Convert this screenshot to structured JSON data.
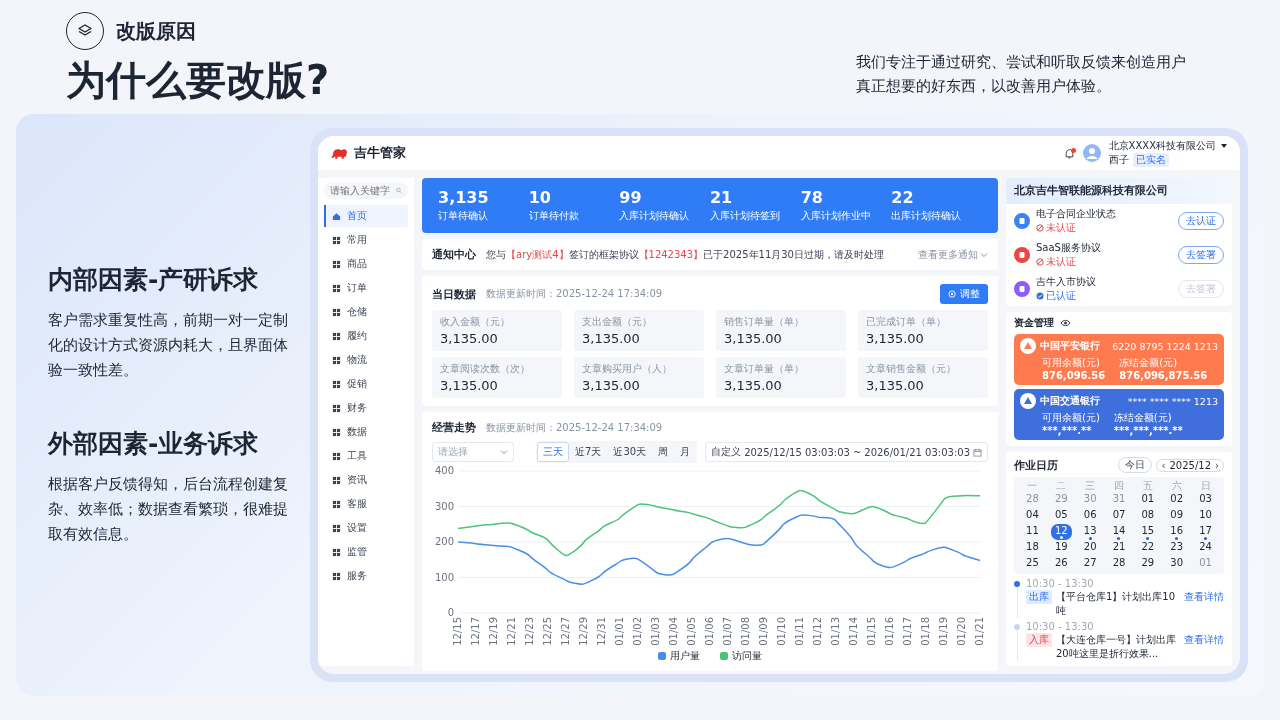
{
  "header": {
    "section_label": "改版原因",
    "title": "为什么要改版?",
    "description": "我们专注于通过研究、尝试和听取反馈来创造用户真正想要的好东西，以改善用户体验。"
  },
  "reasons": [
    {
      "heading": "内部因素-产研诉求",
      "text": "客户需求重复性高，前期一对一定制化的设计方式资源内耗大，且界面体验一致性差。"
    },
    {
      "heading": "外部因素-业务诉求",
      "text": "根据客户反馈得知，后台流程创建复杂、效率低；数据查看繁琐，很难提取有效信息。"
    }
  ],
  "app": {
    "name": "吉牛管家",
    "notification": true,
    "user": {
      "company": "北京XXXX科技有限公司",
      "name": "西子",
      "badge": "已实名"
    }
  },
  "sidebar": {
    "search_placeholder": "请输入关键字",
    "items": [
      {
        "label": "首页",
        "selected": true
      },
      {
        "label": "常用",
        "selected": false
      },
      {
        "label": "商品",
        "selected": false
      },
      {
        "label": "订单",
        "selected": false
      },
      {
        "label": "仓储",
        "selected": false
      },
      {
        "label": "履约",
        "selected": false
      },
      {
        "label": "物流",
        "selected": false
      },
      {
        "label": "促销",
        "selected": false
      },
      {
        "label": "财务",
        "selected": false
      },
      {
        "label": "数据",
        "selected": false
      },
      {
        "label": "工具",
        "selected": false
      },
      {
        "label": "资讯",
        "selected": false
      },
      {
        "label": "客服",
        "selected": false
      },
      {
        "label": "设置",
        "selected": false
      },
      {
        "label": "监管",
        "selected": false
      },
      {
        "label": "服务",
        "selected": false
      }
    ]
  },
  "stats": [
    {
      "value": "3,135",
      "label": "订单待确认"
    },
    {
      "value": "10",
      "label": "订单待付款"
    },
    {
      "value": "99",
      "label": "入库计划待确认"
    },
    {
      "value": "21",
      "label": "入库计划待签到"
    },
    {
      "value": "78",
      "label": "入库计划作业中"
    },
    {
      "value": "22",
      "label": "出库计划待确认"
    }
  ],
  "notice": {
    "title": "通知中心",
    "segments": [
      {
        "text": "您与",
        "highlight": false
      },
      {
        "text": "【ary测试4】",
        "highlight": true
      },
      {
        "text": "签订的框架协议",
        "highlight": false
      },
      {
        "text": "【1242343】",
        "highlight": true
      },
      {
        "text": "已于2025年11月30日过期，请及时处理",
        "highlight": false
      }
    ],
    "more": "查看更多通知"
  },
  "daily": {
    "title": "当日数据",
    "updated": "数据更新时间：2025-12-24 17:34:09",
    "button": "调整",
    "metrics": [
      {
        "label": "收入金额（元）",
        "value": "3,135.00"
      },
      {
        "label": "支出金额（元）",
        "value": "3,135.00"
      },
      {
        "label": "销售订单量（单）",
        "value": "3,135.00"
      },
      {
        "label": "已完成订单（单）",
        "value": "3,135.00"
      },
      {
        "label": "文章阅读次数（次）",
        "value": "3,135.00"
      },
      {
        "label": "文章购买用户（人）",
        "value": "3,135.00"
      },
      {
        "label": "文章订单量（单）",
        "value": "3,135.00"
      },
      {
        "label": "文章销售金额（元）",
        "value": "3,135.00"
      }
    ]
  },
  "trend": {
    "title": "经营走势",
    "updated": "数据更新时间：2025-12-24 17:34:09",
    "select_placeholder": "请选择",
    "ranges": [
      {
        "label": "三天",
        "selected": true
      },
      {
        "label": "近7天",
        "selected": false
      },
      {
        "label": "近30天",
        "selected": false
      },
      {
        "label": "周",
        "selected": false
      },
      {
        "label": "月",
        "selected": false
      }
    ],
    "date_range": {
      "label": "自定义",
      "start": "2025/12/15 03:03:03",
      "separator": "~",
      "end": "2026/01/21 03:03:03"
    },
    "chart_data": {
      "type": "line",
      "grid": true,
      "categories": [
        "12/15",
        "12/17",
        "12/19",
        "12/21",
        "12/23",
        "12/25",
        "12/27",
        "12/29",
        "12/31",
        "01/01",
        "01/02",
        "01/03",
        "01/04",
        "01/05",
        "01/06",
        "01/07",
        "01/08",
        "01/09",
        "01/10",
        "01/11",
        "01/12",
        "01/13",
        "01/14",
        "01/15",
        "01/16",
        "01/17",
        "01/18",
        "01/19",
        "01/20",
        "01/21"
      ],
      "ylim": [
        0,
        400
      ],
      "yticks": [
        0,
        100,
        200,
        300,
        400
      ],
      "series": [
        {
          "name": "用户量",
          "color": "#4a8fe7",
          "values": [
            200,
            195,
            190,
            185,
            160,
            120,
            92,
            82,
            110,
            145,
            152,
            115,
            110,
            150,
            195,
            210,
            195,
            195,
            245,
            275,
            270,
            260,
            200,
            150,
            128,
            150,
            170,
            185,
            165,
            148
          ]
        },
        {
          "name": "访问量",
          "color": "#4cc57a",
          "values": [
            238,
            245,
            250,
            252,
            230,
            205,
            162,
            200,
            240,
            268,
            305,
            300,
            290,
            280,
            265,
            245,
            242,
            270,
            310,
            345,
            320,
            290,
            280,
            300,
            280,
            265,
            255,
            320,
            330,
            330
          ]
        }
      ]
    }
  },
  "company": {
    "title": "北京吉牛智联能源科技有限公司",
    "agreements": [
      {
        "title": "电子合同企业状态",
        "status": "未认证",
        "verified": false,
        "action": "去认证",
        "disabled": false,
        "color": "#3b82f6"
      },
      {
        "title": "SaaS服务协议",
        "status": "未认证",
        "verified": false,
        "action": "去签署",
        "disabled": false,
        "color": "#ef4444"
      },
      {
        "title": "吉牛入市协议",
        "status": "已认证",
        "verified": true,
        "action": "去签署",
        "disabled": true,
        "color": "#8b5cf6"
      }
    ]
  },
  "funds": {
    "title": "资金管理",
    "banks": [
      {
        "name": "中国平安银行",
        "number": "6220 8795 1224 1213",
        "color": "#ff7b4f",
        "fields": [
          {
            "label": "可用余额(元)",
            "value": "876,096.56"
          },
          {
            "label": "冻结金额(元)",
            "value": "876,096,875.56"
          }
        ]
      },
      {
        "name": "中国交通银行",
        "number": "**** **** **** 1213",
        "color": "#3f6fdc",
        "fields": [
          {
            "label": "可用余额(元)",
            "value": "***,***.**"
          },
          {
            "label": "冻结金额(元)",
            "value": "***,***,***.**"
          }
        ]
      }
    ]
  },
  "calendar": {
    "title": "作业日历",
    "today": "今日",
    "prev": "‹",
    "month": "2025/12",
    "next": "›",
    "weekdays": [
      "一",
      "二",
      "三",
      "四",
      "五",
      "六",
      "日"
    ],
    "days": [
      {
        "label": "28",
        "outside": true,
        "selected": false,
        "event": false
      },
      {
        "label": "29",
        "outside": true,
        "selected": false,
        "event": false
      },
      {
        "label": "30",
        "outside": true,
        "selected": false,
        "event": false
      },
      {
        "label": "31",
        "outside": true,
        "selected": false,
        "event": false
      },
      {
        "label": "01",
        "outside": false,
        "selected": false,
        "event": false
      },
      {
        "label": "02",
        "outside": false,
        "selected": false,
        "event": false
      },
      {
        "label": "03",
        "outside": false,
        "selected": false,
        "event": false
      },
      {
        "label": "04",
        "outside": false,
        "selected": false,
        "event": false
      },
      {
        "label": "05",
        "outside": false,
        "selected": false,
        "event": false
      },
      {
        "label": "06",
        "outside": false,
        "selected": false,
        "event": false
      },
      {
        "label": "07",
        "outside": false,
        "selected": false,
        "event": false
      },
      {
        "label": "08",
        "outside": false,
        "selected": false,
        "event": false
      },
      {
        "label": "09",
        "outside": false,
        "selected": false,
        "event": false
      },
      {
        "label": "10",
        "outside": false,
        "selected": false,
        "event": false
      },
      {
        "label": "11",
        "outside": false,
        "selected": false,
        "event": false
      },
      {
        "label": "12",
        "outside": false,
        "selected": true,
        "event": true
      },
      {
        "label": "13",
        "outside": false,
        "selected": false,
        "event": true
      },
      {
        "label": "14",
        "outside": false,
        "selected": false,
        "event": true
      },
      {
        "label": "15",
        "outside": false,
        "selected": false,
        "event": true
      },
      {
        "label": "16",
        "outside": false,
        "selected": false,
        "event": true
      },
      {
        "label": "17",
        "outside": false,
        "selected": false,
        "event": true
      },
      {
        "label": "18",
        "outside": false,
        "selected": false,
        "event": false
      },
      {
        "label": "19",
        "outside": false,
        "selected": false,
        "event": false
      },
      {
        "label": "20",
        "outside": false,
        "selected": false,
        "event": false
      },
      {
        "label": "21",
        "outside": false,
        "selected": false,
        "event": false
      },
      {
        "label": "22",
        "outside": false,
        "selected": false,
        "event": false
      },
      {
        "label": "23",
        "outside": false,
        "selected": false,
        "event": false
      },
      {
        "label": "24",
        "outside": false,
        "selected": false,
        "event": false
      },
      {
        "label": "25",
        "outside": false,
        "selected": false,
        "event": false
      },
      {
        "label": "26",
        "outside": false,
        "selected": false,
        "event": false
      },
      {
        "label": "27",
        "outside": false,
        "selected": false,
        "event": false
      },
      {
        "label": "28",
        "outside": false,
        "selected": false,
        "event": false
      },
      {
        "label": "29",
        "outside": false,
        "selected": false,
        "event": false
      },
      {
        "label": "30",
        "outside": false,
        "selected": false,
        "event": false
      },
      {
        "label": "01",
        "outside": true,
        "selected": false,
        "event": false
      }
    ],
    "events": [
      {
        "time": "10:30 - 13:30",
        "kind": "out",
        "tag": "出库",
        "text": "【平台仓库1】计划出库10吨",
        "link": "查看详情",
        "active": true
      },
      {
        "time": "10:30 - 13:30",
        "kind": "in",
        "tag": "入库",
        "text": "【大连仓库一号】计划出库20吨这里是折行效果...",
        "link": "查看详情",
        "active": false
      }
    ]
  }
}
